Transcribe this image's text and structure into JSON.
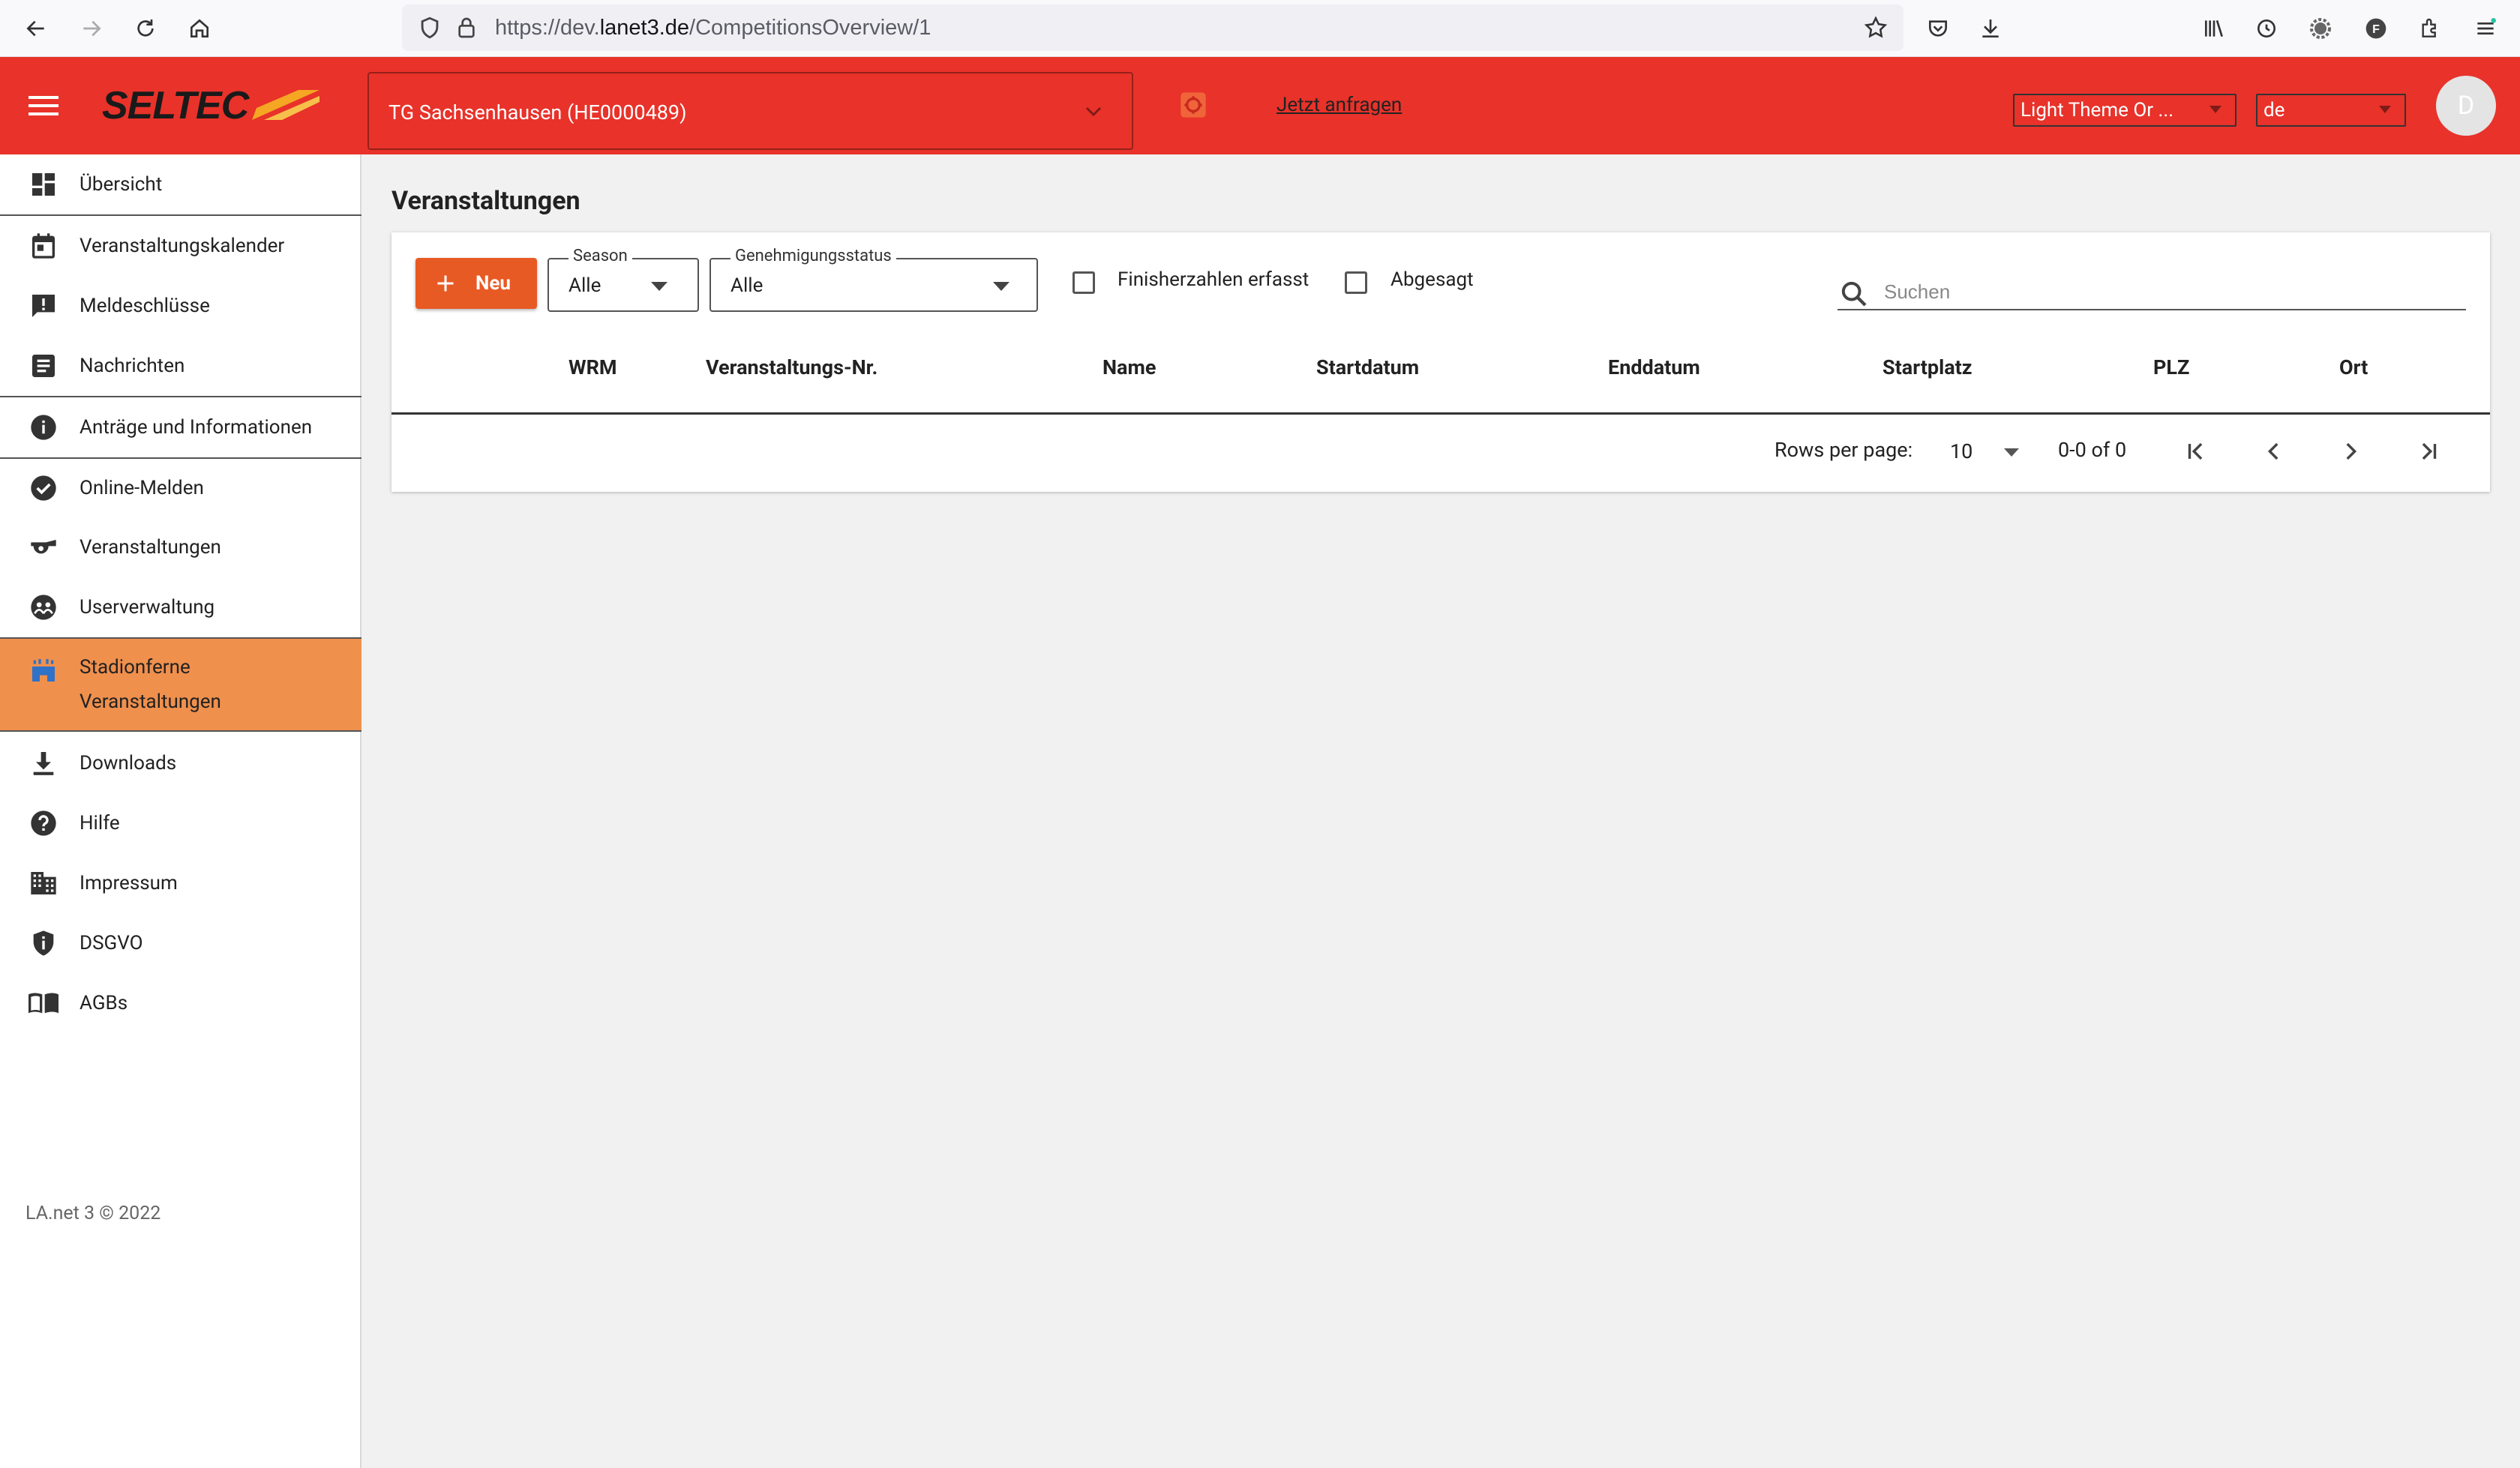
{
  "browser": {
    "url_prefix": "https://dev.",
    "url_domain": "lanet3.de",
    "url_path": "/CompetitionsOverview/1"
  },
  "header": {
    "logo_text": "SELTEC",
    "organization": "TG Sachsenhausen (HE0000489)",
    "request_link": "Jetzt anfragen",
    "theme_value": "Light Theme Or ...",
    "language_value": "de",
    "avatar_initial": "D",
    "accent_color": "#e8322a"
  },
  "sidebar": {
    "items": [
      {
        "label": "Übersicht",
        "icon": "dashboard-icon"
      },
      {
        "label": "Veranstaltungskalender",
        "icon": "calendar-icon"
      },
      {
        "label": "Meldeschlüsse",
        "icon": "alert-message-icon"
      },
      {
        "label": "Nachrichten",
        "icon": "article-icon"
      },
      {
        "label": "Anträge und Informationen",
        "icon": "info-icon"
      },
      {
        "label": "Online-Melden",
        "icon": "check-circle-icon"
      },
      {
        "label": "Veranstaltungen",
        "icon": "whistle-icon"
      },
      {
        "label": "Userverwaltung",
        "icon": "users-icon"
      },
      {
        "label": "Stadionferne Veranstaltungen",
        "label_line1": "Stadionferne",
        "label_line2": "Veranstaltungen",
        "icon": "stadium-icon",
        "active": true
      },
      {
        "label": "Downloads",
        "icon": "download-icon"
      },
      {
        "label": "Hilfe",
        "icon": "help-icon"
      },
      {
        "label": "Impressum",
        "icon": "building-icon"
      },
      {
        "label": "DSGVO",
        "icon": "shield-info-icon"
      },
      {
        "label": "AGBs",
        "icon": "book-icon"
      }
    ],
    "copyright": "LA.net 3 © 2022",
    "active_color": "#f0904d"
  },
  "main": {
    "title": "Veranstaltungen",
    "new_button": "Neu",
    "season_label": "Season",
    "season_value": "Alle",
    "status_label": "Genehmigungsstatus",
    "status_value": "Alle",
    "checkbox_finisher": "Finisherzahlen erfasst",
    "checkbox_cancelled": "Abgesagt",
    "search_placeholder": "Suchen",
    "columns": [
      "WRM",
      "Veranstaltungs-Nr.",
      "Name",
      "Startdatum",
      "Enddatum",
      "Startplatz",
      "PLZ",
      "Ort"
    ],
    "rows": [],
    "pagination": {
      "rows_per_page_label": "Rows per page:",
      "rows_per_page": "10",
      "range": "0-0 of 0"
    },
    "button_color": "#e85a24"
  }
}
